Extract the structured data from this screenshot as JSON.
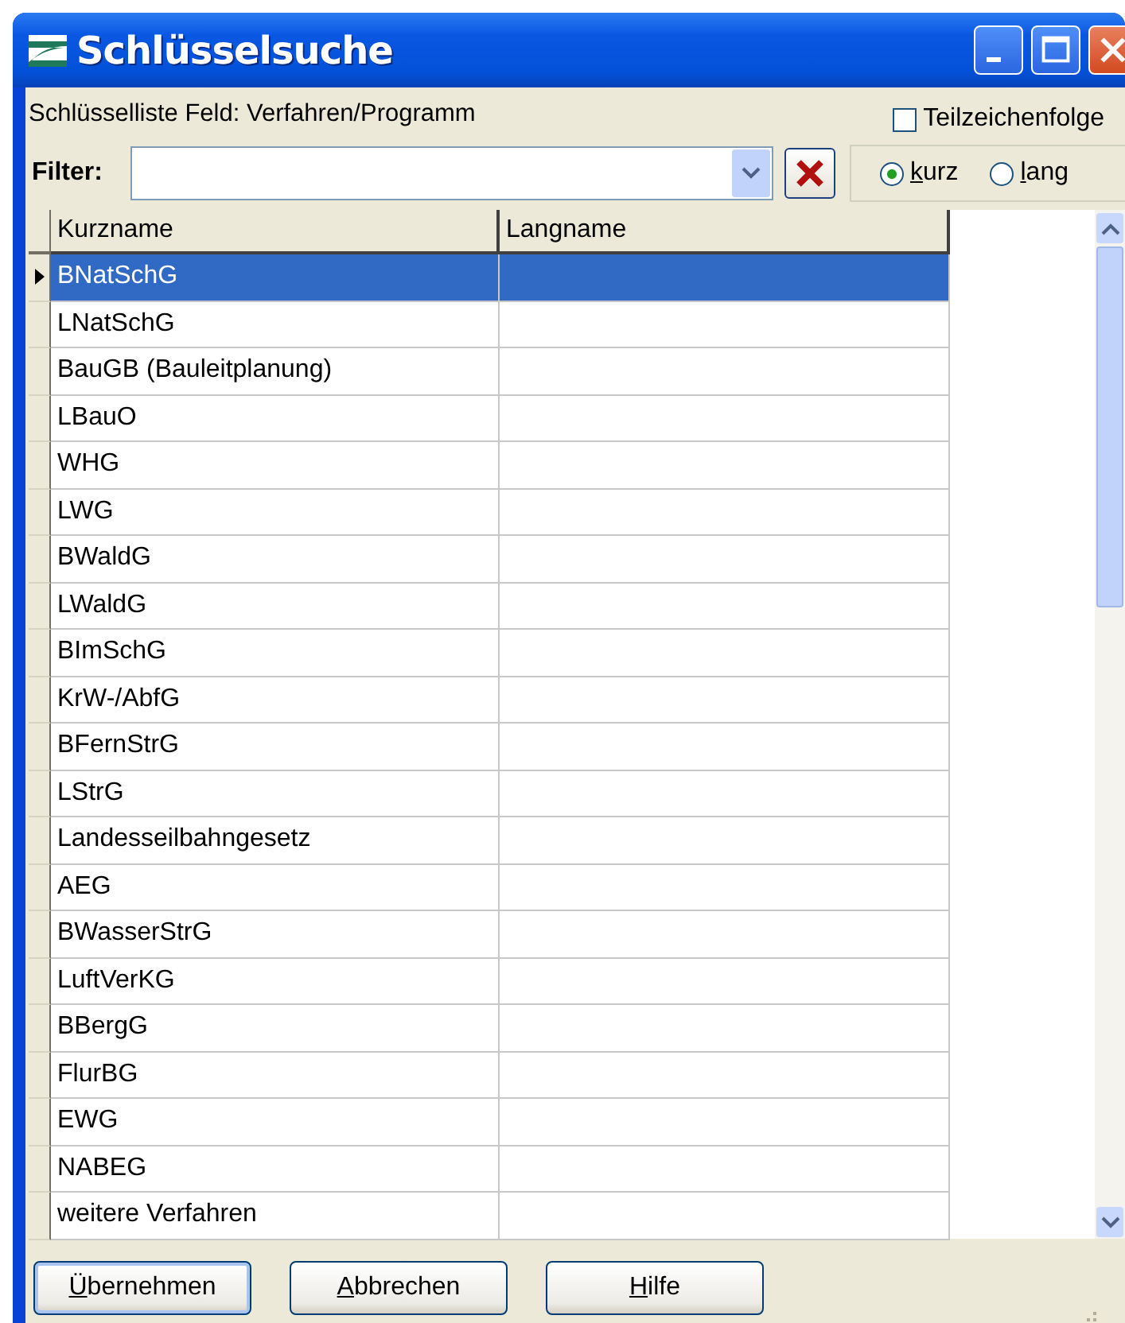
{
  "window": {
    "title": "Schlüsselsuche"
  },
  "info": "Schlüsselliste Feld: Verfahren/Programm",
  "substring": {
    "label": "Teilzeichenfolge",
    "checked": false
  },
  "filter": {
    "label": "Filter:"
  },
  "mode": [
    {
      "label": "kurz",
      "selected": true
    },
    {
      "label": "lang",
      "selected": false
    }
  ],
  "table": {
    "columns": [
      "Kurzname",
      "Langname"
    ],
    "rows": [
      {
        "kurzname": "BNatSchG",
        "selected": true
      },
      {
        "kurzname": "LNatSchG",
        "selected": false
      },
      {
        "kurzname": "BauGB (Bauleitplanung)",
        "selected": false
      },
      {
        "kurzname": "LBauO",
        "selected": false
      },
      {
        "kurzname": "WHG",
        "selected": false
      },
      {
        "kurzname": "LWG",
        "selected": false
      },
      {
        "kurzname": "BWaldG",
        "selected": false
      },
      {
        "kurzname": "LWaldG",
        "selected": false
      },
      {
        "kurzname": "BImSchG",
        "selected": false
      },
      {
        "kurzname": "KrW-/AbfG",
        "selected": false
      },
      {
        "kurzname": "BFernStrG",
        "selected": false
      },
      {
        "kurzname": "LStrG",
        "selected": false
      },
      {
        "kurzname": "Landesseilbahngesetz",
        "selected": false
      },
      {
        "kurzname": "AEG",
        "selected": false
      },
      {
        "kurzname": "BWasserStrG",
        "selected": false
      },
      {
        "kurzname": "LuftVerKG",
        "selected": false
      },
      {
        "kurzname": "BBergG",
        "selected": false
      },
      {
        "kurzname": "FlurBG",
        "selected": false
      },
      {
        "kurzname": "EWG",
        "selected": false
      },
      {
        "kurzname": "NABEG",
        "selected": false
      },
      {
        "kurzname": "weitere Verfahren",
        "selected": false
      }
    ]
  },
  "buttons": [
    "Übernehmen",
    "Abbrechen",
    "Hilfe"
  ]
}
